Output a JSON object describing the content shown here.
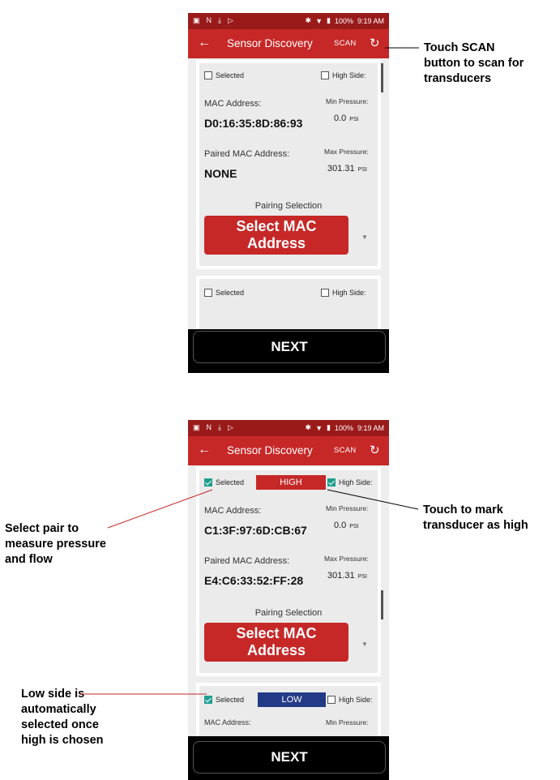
{
  "status_bar": {
    "icons_left": [
      "image-icon",
      "n-icon",
      "download-icon",
      "play-icon"
    ],
    "battery": "100%",
    "time": "9:19 AM"
  },
  "app_bar": {
    "back": "←",
    "title": "Sensor Discovery",
    "scan_label": "SCAN",
    "refresh": "↻"
  },
  "labels": {
    "selected": "Selected",
    "high_side": "High Side:",
    "mac_address": "MAC Address:",
    "paired_mac_address": "Paired MAC Address:",
    "min_pressure": "Min Pressure:",
    "max_pressure": "Max Pressure:",
    "psi": "PSI",
    "pairing_selection": "Pairing Selection",
    "select_mac_line1": "Select MAC",
    "select_mac_line2": "Address",
    "next": "NEXT",
    "partial_min_pressure": "Min Pressure:",
    "partial_mac": "MAC Address:"
  },
  "screen1": {
    "sensor1": {
      "selected": false,
      "high_side": false,
      "mac": "D0:16:35:8D:86:93",
      "paired_mac": "NONE",
      "min_pressure": "0.0",
      "max_pressure": "301.31"
    },
    "sensor2": {
      "selected": false,
      "high_side": false
    }
  },
  "screen2": {
    "sensor1": {
      "selected": true,
      "high_side": true,
      "badge": "HIGH",
      "mac": "C1:3F:97:6D:CB:67",
      "paired_mac": "E4:C6:33:52:FF:28",
      "min_pressure": "0.0",
      "max_pressure": "301.31"
    },
    "sensor2": {
      "selected": true,
      "high_side": false,
      "badge": "LOW"
    }
  },
  "annotations": {
    "scan": [
      "Touch SCAN",
      "button to scan for",
      "transducers"
    ],
    "select_pair": [
      "Select pair to",
      "measure pressure",
      "and flow"
    ],
    "mark_high": [
      "Touch to mark",
      "transducer as high"
    ],
    "low_side": [
      "Low side is",
      "automatically",
      "selected once",
      "high is chosen"
    ]
  },
  "colors": {
    "app_bar": "#c62828",
    "status_bar": "#9a1a1a",
    "high_badge": "#c62828",
    "low_badge": "#233a86",
    "checkbox_checked": "#1f9e8f"
  }
}
